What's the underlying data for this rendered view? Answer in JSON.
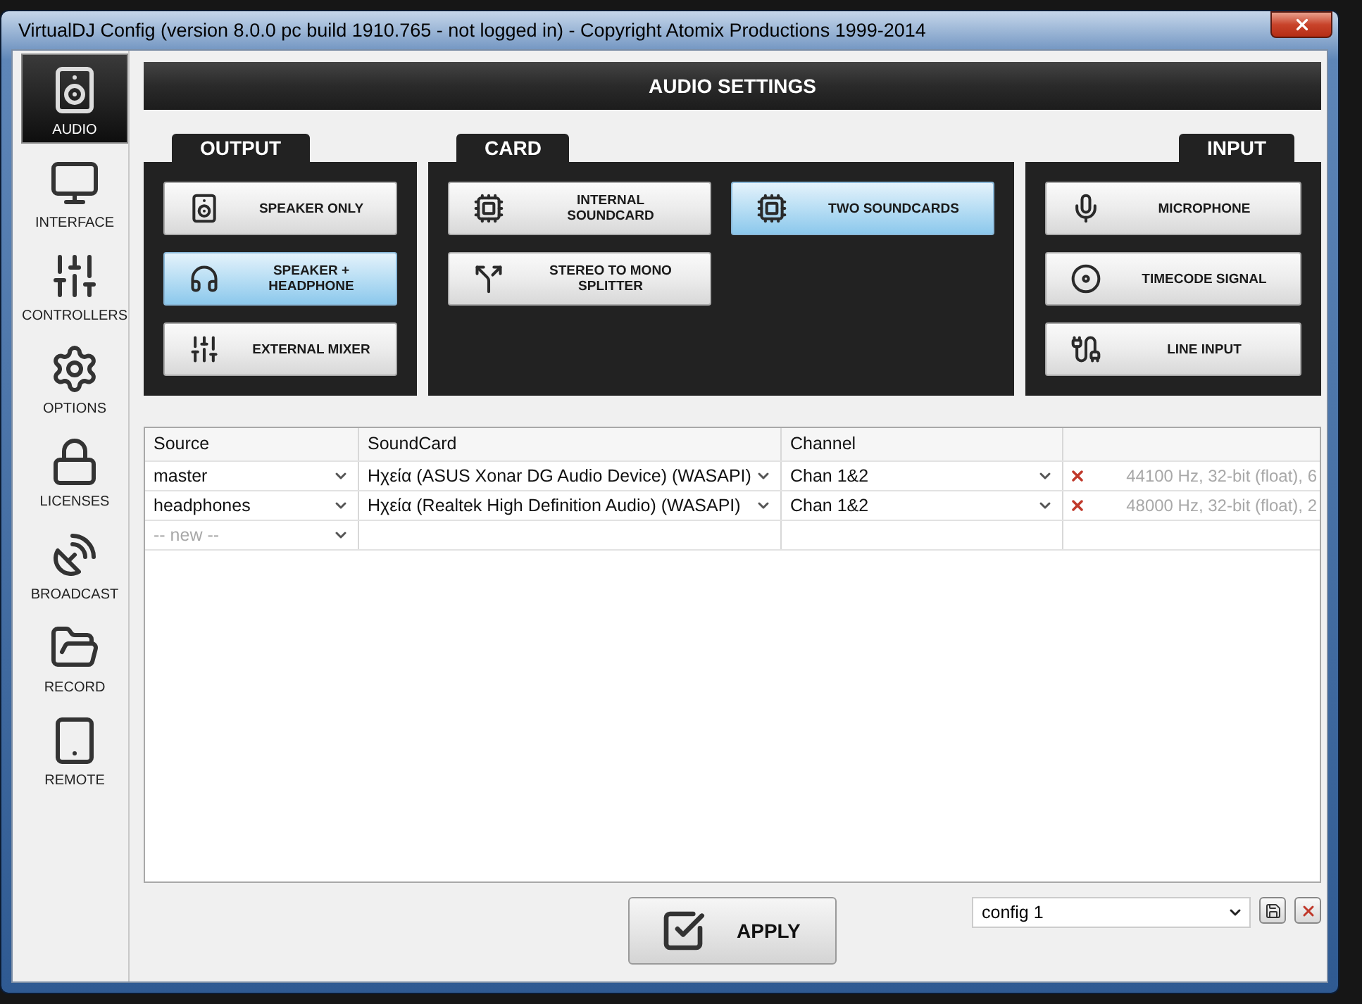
{
  "window": {
    "title": "VirtualDJ Config (version 8.0.0 pc build 1910.765 - not logged in) - Copyright Atomix Productions 1999-2014"
  },
  "sidebar": {
    "items": [
      {
        "label": "AUDIO",
        "kind": "speaker",
        "selected": true
      },
      {
        "label": "INTERFACE",
        "kind": "monitor",
        "selected": false
      },
      {
        "label": "CONTROLLERS",
        "kind": "sliders",
        "selected": false
      },
      {
        "label": "OPTIONS",
        "kind": "gear",
        "selected": false
      },
      {
        "label": "LICENSES",
        "kind": "lock",
        "selected": false
      },
      {
        "label": "BROADCAST",
        "kind": "dish",
        "selected": false
      },
      {
        "label": "RECORD",
        "kind": "folder",
        "selected": false
      },
      {
        "label": "REMOTE",
        "kind": "tablet",
        "selected": false
      }
    ]
  },
  "header": {
    "title": "AUDIO SETTINGS"
  },
  "panels": [
    {
      "title": "OUTPUT",
      "kind": "output",
      "buttons": [
        {
          "label": "SPEAKER ONLY",
          "kind": "speaker",
          "selected": false
        },
        {
          "label": "SPEAKER + HEADPHONE",
          "kind": "headphones",
          "selected": true
        },
        {
          "label": "EXTERNAL MIXER",
          "kind": "sliders",
          "selected": false
        }
      ]
    },
    {
      "title": "CARD",
      "kind": "card",
      "buttons": [
        {
          "label": "INTERNAL SOUNDCARD",
          "kind": "card",
          "selected": false
        },
        {
          "label": "TWO SOUNDCARDS",
          "kind": "cards",
          "selected": true
        },
        {
          "label": "STEREO TO MONO SPLITTER",
          "kind": "splitter",
          "selected": false
        }
      ]
    },
    {
      "title": "INPUT",
      "kind": "input",
      "buttons": [
        {
          "label": "MICROPHONE",
          "kind": "mic",
          "selected": false
        },
        {
          "label": "TIMECODE SIGNAL",
          "kind": "disc",
          "selected": false
        },
        {
          "label": "LINE INPUT",
          "kind": "cable",
          "selected": false
        }
      ]
    }
  ],
  "table": {
    "columns": [
      "Source",
      "SoundCard",
      "Channel"
    ],
    "rows": [
      {
        "source": "master",
        "soundcard": "Ηχεία (ASUS Xonar DG Audio Device) (WASAPI)",
        "channel": "Chan 1&2",
        "info": "44100 Hz, 32-bit (float), 6"
      },
      {
        "source": "headphones",
        "soundcard": "Ηχεία (Realtek High Definition Audio) (WASAPI)",
        "channel": "Chan 1&2",
        "info": "48000 Hz, 32-bit (float), 2"
      }
    ],
    "new_row": {
      "placeholder": "-- new --"
    }
  },
  "footer": {
    "apply": "APPLY",
    "config": {
      "value": "config 1"
    }
  }
}
